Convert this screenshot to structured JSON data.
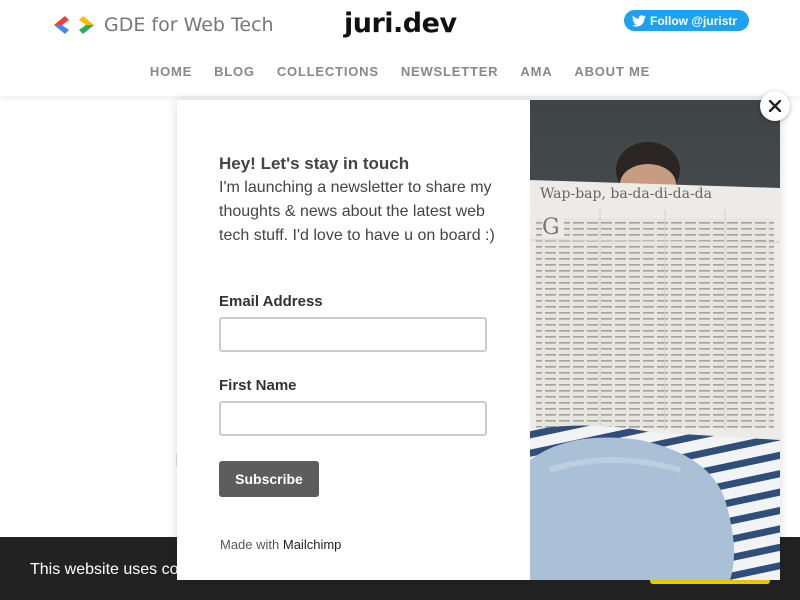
{
  "header": {
    "gde_label": "GDE for Web Tech",
    "brand": "juri.dev",
    "follow_label": "Follow @juristr"
  },
  "nav": {
    "items": [
      "HOME",
      "BLOG",
      "COLLECTIONS",
      "NEWSLETTER",
      "AMA",
      "ABOUT ME"
    ]
  },
  "modal": {
    "heading": "Hey! Let's stay in touch",
    "intro": "I'm launching a newsletter to share my thoughts & news about the latest web tech stuff. I'd love to have u on board :)",
    "email_label": "Email Address",
    "email_value": "",
    "first_name_label": "First Name",
    "first_name_value": "",
    "subscribe_label": "Subscribe",
    "made_with": "Made with",
    "mailchimp": "Mailchimp",
    "newspaper_headline": "Wap-bap, ba-da-di-da-da"
  },
  "cookie": {
    "text": "This website uses coo"
  },
  "colors": {
    "twitter": "#1da1f2",
    "cookie_bg": "#222222",
    "cookie_button": "#f1d600",
    "subscribe_bg": "#5d5d5d"
  },
  "icons": {
    "gde": "code-brackets-icon",
    "twitter": "twitter-bird-icon",
    "close": "close-icon"
  }
}
